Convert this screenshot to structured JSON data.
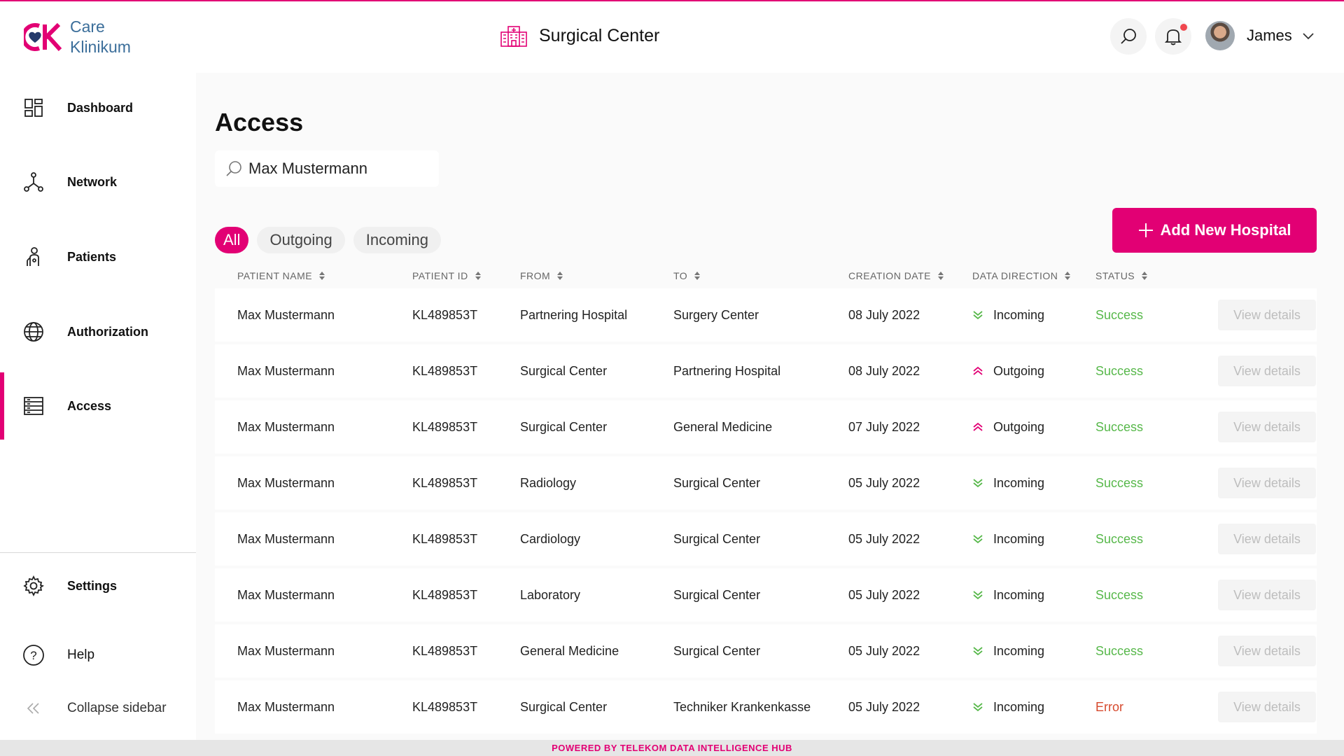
{
  "brand": {
    "logo_line1": "Care",
    "logo_line2": "Klinikum",
    "accent": "#e20074"
  },
  "sidebar": {
    "items": [
      {
        "label": "Dashboard",
        "icon": "dashboard-icon"
      },
      {
        "label": "Network",
        "icon": "network-icon"
      },
      {
        "label": "Patients",
        "icon": "patients-icon"
      },
      {
        "label": "Authorization",
        "icon": "globe-icon"
      },
      {
        "label": "Access",
        "icon": "server-rack-icon",
        "active": true
      }
    ],
    "settings_label": "Settings",
    "help_label": "Help",
    "collapse_label": "Collapse sidebar"
  },
  "header": {
    "title": "Surgical Center",
    "user_name": "James"
  },
  "page": {
    "title": "Access",
    "search_value": "Max Mustermann"
  },
  "filters": [
    {
      "label": "All",
      "active": true
    },
    {
      "label": "Outgoing",
      "active": false
    },
    {
      "label": "Incoming",
      "active": false
    }
  ],
  "add_button_label": "Add New Hospital",
  "table": {
    "columns": [
      "Patient Name",
      "Patient ID",
      "From",
      "To",
      "Creation Date",
      "Data Direction",
      "Status"
    ],
    "view_label": "View details",
    "rows": [
      {
        "name": "Max Mustermann",
        "id": "KL489853T",
        "from": "Partnering Hospital",
        "to": "Surgery Center",
        "date": "08 July 2022",
        "direction": "Incoming",
        "status": "Success"
      },
      {
        "name": "Max Mustermann",
        "id": "KL489853T",
        "from": "Surgical Center",
        "to": "Partnering Hospital",
        "date": "08 July 2022",
        "direction": "Outgoing",
        "status": "Success"
      },
      {
        "name": "Max Mustermann",
        "id": "KL489853T",
        "from": "Surgical Center",
        "to": "General Medicine",
        "date": "07 July 2022",
        "direction": "Outgoing",
        "status": "Success"
      },
      {
        "name": "Max Mustermann",
        "id": "KL489853T",
        "from": "Radiology",
        "to": "Surgical Center",
        "date": "05 July 2022",
        "direction": "Incoming",
        "status": "Success"
      },
      {
        "name": "Max Mustermann",
        "id": "KL489853T",
        "from": "Cardiology",
        "to": "Surgical Center",
        "date": "05 July 2022",
        "direction": "Incoming",
        "status": "Success"
      },
      {
        "name": "Max Mustermann",
        "id": "KL489853T",
        "from": "Laboratory",
        "to": "Surgical Center",
        "date": "05 July 2022",
        "direction": "Incoming",
        "status": "Success"
      },
      {
        "name": "Max Mustermann",
        "id": "KL489853T",
        "from": "General Medicine",
        "to": "Surgical Center",
        "date": "05 July 2022",
        "direction": "Incoming",
        "status": "Success"
      },
      {
        "name": "Max Mustermann",
        "id": "KL489853T",
        "from": "Surgical Center",
        "to": "Techniker Krankenkasse",
        "date": "05 July 2022",
        "direction": "Incoming",
        "status": "Error"
      }
    ]
  },
  "footer_text": "POWERED BY TELEKOM DATA INTELLIGENCE HUB",
  "colors": {
    "success": "#57b84a",
    "error": "#d64a2e",
    "incoming": "#57b84a",
    "outgoing": "#e20074"
  }
}
